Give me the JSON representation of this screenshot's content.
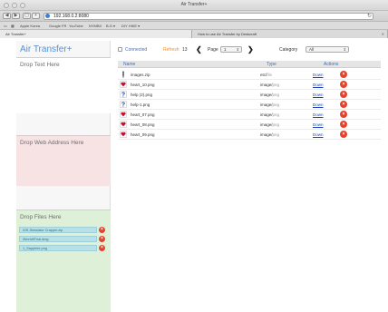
{
  "browser": {
    "window_title": "Air Transfer+",
    "url": "192.168.0.2:8080",
    "bookmarks": [
      "Apple Korea",
      "Google FR",
      "YouTube",
      "NYMBX",
      "B.G ▾",
      "DIY HIKE ▾"
    ],
    "tabs": [
      {
        "label": "Air Transfer+"
      },
      {
        "label": "How to use Air Transfer by Deskcraft"
      }
    ]
  },
  "app": {
    "brand": "Air Transfer+",
    "drop_text_title": "Drop Text Here",
    "drop_web_title": "Drop Web Address Here",
    "drop_files_title": "Drop Files Here",
    "queued_files": [
      {
        "name": "iOS-Simulator Crapper.zip"
      },
      {
        "name": "iWorld9Trial.dmg"
      },
      {
        "name": "1_Sapphire.png"
      }
    ]
  },
  "toolbar": {
    "connected_label": "Connected",
    "refresh_label": "Refresh",
    "refresh_count": "13",
    "page_label": "Page",
    "page_value": "1",
    "category_label": "Category",
    "category_value": "All"
  },
  "table": {
    "headers": {
      "name": "Name",
      "type": "Type",
      "actions": "Actions"
    },
    "rows": [
      {
        "name": "images.zip",
        "type_main": "etc/",
        "type_sub": "file",
        "icon": "zip-icon",
        "action": "Down"
      },
      {
        "name": "heart_10.png",
        "type_main": "image/",
        "type_sub": "png",
        "icon": "heart-image-icon",
        "action": "Down"
      },
      {
        "name": "help (2).png",
        "type_main": "image/",
        "type_sub": "png",
        "icon": "question-image-icon",
        "action": "Down"
      },
      {
        "name": "help-1.png",
        "type_main": "image/",
        "type_sub": "png",
        "icon": "question-image-icon",
        "action": "Down"
      },
      {
        "name": "heart_07.png",
        "type_main": "image/",
        "type_sub": "png",
        "icon": "heart-image-icon",
        "action": "Down"
      },
      {
        "name": "heart_08.png",
        "type_main": "image/",
        "type_sub": "png",
        "icon": "heart-image-icon",
        "action": "Down"
      },
      {
        "name": "heart_09.png",
        "type_main": "image/",
        "type_sub": "png",
        "icon": "heart-image-icon",
        "action": "Down"
      }
    ]
  },
  "colors": {
    "brand": "#5a8fd4",
    "refresh": "#f08c1f",
    "delete": "#e4422b",
    "link": "#1a44b8",
    "web_panel": "#f7e3e3",
    "files_panel": "#dff0d8",
    "file_chip": "#b7e0e7"
  }
}
